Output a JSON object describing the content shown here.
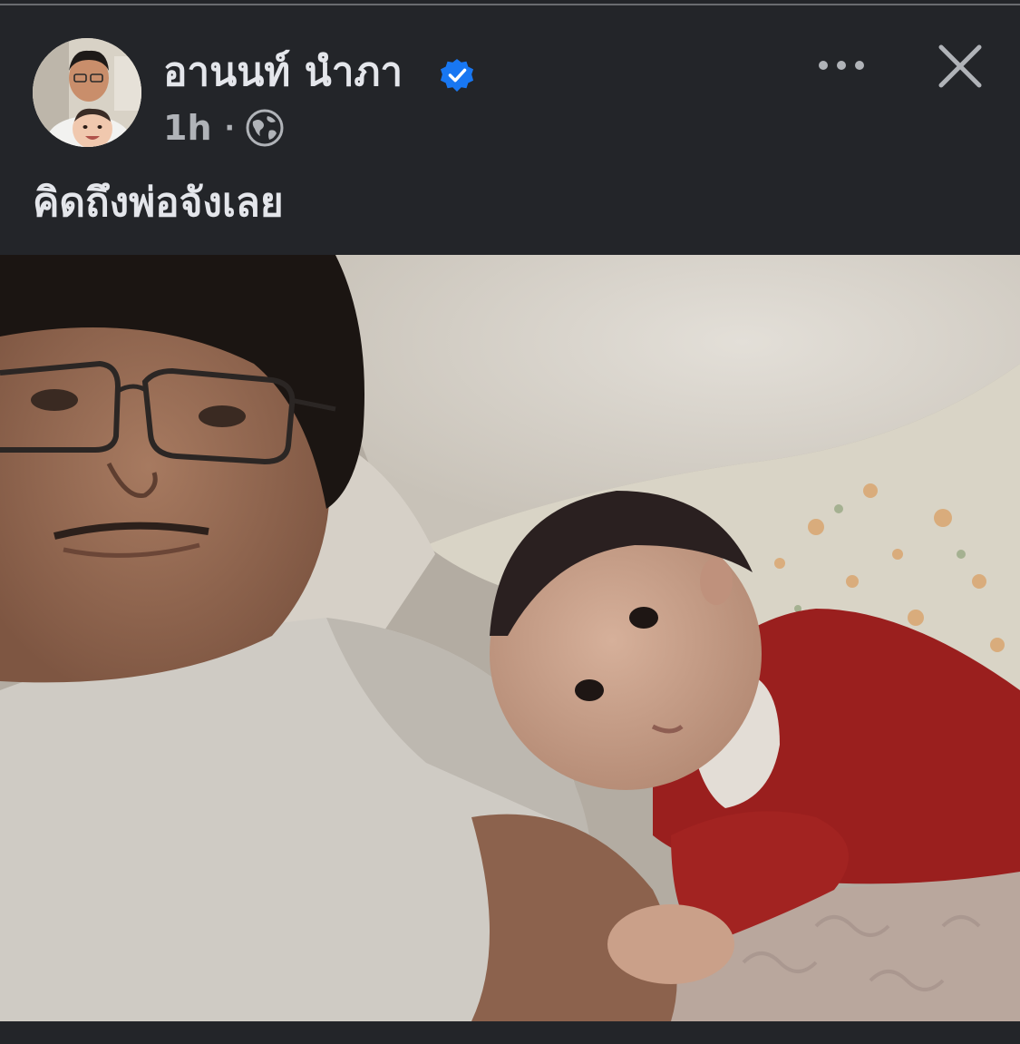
{
  "post": {
    "author_name": "อานนท์ นำภา",
    "verified": true,
    "timestamp": "1h",
    "separator": "·",
    "audience_icon": "globe-icon",
    "caption": "คิดถึงพ่อจังเลย"
  },
  "header": {
    "more_icon": "more-horizontal-icon",
    "close_icon": "close-icon"
  },
  "colors": {
    "background": "#232529",
    "primary_text": "#e4e6eb",
    "secondary_text": "#b0b3b8",
    "verified_badge": "#1877f2"
  }
}
